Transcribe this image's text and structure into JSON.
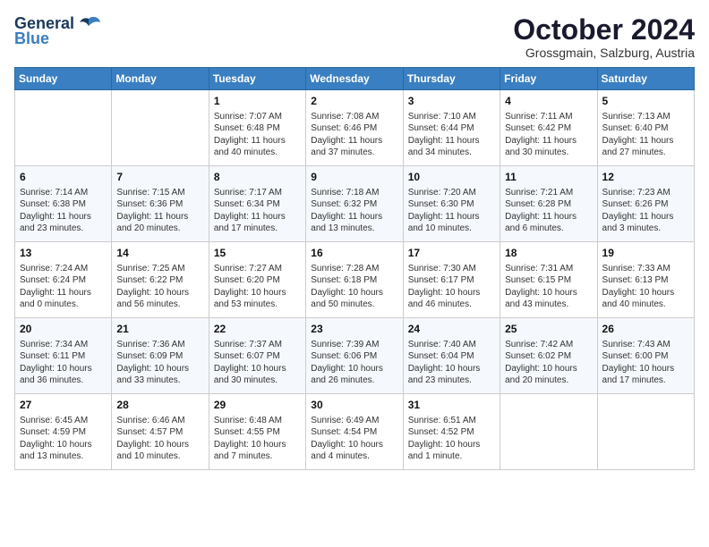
{
  "header": {
    "logo_general": "General",
    "logo_blue": "Blue",
    "month_title": "October 2024",
    "location": "Grossgmain, Salzburg, Austria"
  },
  "days_of_week": [
    "Sunday",
    "Monday",
    "Tuesday",
    "Wednesday",
    "Thursday",
    "Friday",
    "Saturday"
  ],
  "weeks": [
    [
      {
        "day": "",
        "info": ""
      },
      {
        "day": "",
        "info": ""
      },
      {
        "day": "1",
        "info": "Sunrise: 7:07 AM\nSunset: 6:48 PM\nDaylight: 11 hours and 40 minutes."
      },
      {
        "day": "2",
        "info": "Sunrise: 7:08 AM\nSunset: 6:46 PM\nDaylight: 11 hours and 37 minutes."
      },
      {
        "day": "3",
        "info": "Sunrise: 7:10 AM\nSunset: 6:44 PM\nDaylight: 11 hours and 34 minutes."
      },
      {
        "day": "4",
        "info": "Sunrise: 7:11 AM\nSunset: 6:42 PM\nDaylight: 11 hours and 30 minutes."
      },
      {
        "day": "5",
        "info": "Sunrise: 7:13 AM\nSunset: 6:40 PM\nDaylight: 11 hours and 27 minutes."
      }
    ],
    [
      {
        "day": "6",
        "info": "Sunrise: 7:14 AM\nSunset: 6:38 PM\nDaylight: 11 hours and 23 minutes."
      },
      {
        "day": "7",
        "info": "Sunrise: 7:15 AM\nSunset: 6:36 PM\nDaylight: 11 hours and 20 minutes."
      },
      {
        "day": "8",
        "info": "Sunrise: 7:17 AM\nSunset: 6:34 PM\nDaylight: 11 hours and 17 minutes."
      },
      {
        "day": "9",
        "info": "Sunrise: 7:18 AM\nSunset: 6:32 PM\nDaylight: 11 hours and 13 minutes."
      },
      {
        "day": "10",
        "info": "Sunrise: 7:20 AM\nSunset: 6:30 PM\nDaylight: 11 hours and 10 minutes."
      },
      {
        "day": "11",
        "info": "Sunrise: 7:21 AM\nSunset: 6:28 PM\nDaylight: 11 hours and 6 minutes."
      },
      {
        "day": "12",
        "info": "Sunrise: 7:23 AM\nSunset: 6:26 PM\nDaylight: 11 hours and 3 minutes."
      }
    ],
    [
      {
        "day": "13",
        "info": "Sunrise: 7:24 AM\nSunset: 6:24 PM\nDaylight: 11 hours and 0 minutes."
      },
      {
        "day": "14",
        "info": "Sunrise: 7:25 AM\nSunset: 6:22 PM\nDaylight: 10 hours and 56 minutes."
      },
      {
        "day": "15",
        "info": "Sunrise: 7:27 AM\nSunset: 6:20 PM\nDaylight: 10 hours and 53 minutes."
      },
      {
        "day": "16",
        "info": "Sunrise: 7:28 AM\nSunset: 6:18 PM\nDaylight: 10 hours and 50 minutes."
      },
      {
        "day": "17",
        "info": "Sunrise: 7:30 AM\nSunset: 6:17 PM\nDaylight: 10 hours and 46 minutes."
      },
      {
        "day": "18",
        "info": "Sunrise: 7:31 AM\nSunset: 6:15 PM\nDaylight: 10 hours and 43 minutes."
      },
      {
        "day": "19",
        "info": "Sunrise: 7:33 AM\nSunset: 6:13 PM\nDaylight: 10 hours and 40 minutes."
      }
    ],
    [
      {
        "day": "20",
        "info": "Sunrise: 7:34 AM\nSunset: 6:11 PM\nDaylight: 10 hours and 36 minutes."
      },
      {
        "day": "21",
        "info": "Sunrise: 7:36 AM\nSunset: 6:09 PM\nDaylight: 10 hours and 33 minutes."
      },
      {
        "day": "22",
        "info": "Sunrise: 7:37 AM\nSunset: 6:07 PM\nDaylight: 10 hours and 30 minutes."
      },
      {
        "day": "23",
        "info": "Sunrise: 7:39 AM\nSunset: 6:06 PM\nDaylight: 10 hours and 26 minutes."
      },
      {
        "day": "24",
        "info": "Sunrise: 7:40 AM\nSunset: 6:04 PM\nDaylight: 10 hours and 23 minutes."
      },
      {
        "day": "25",
        "info": "Sunrise: 7:42 AM\nSunset: 6:02 PM\nDaylight: 10 hours and 20 minutes."
      },
      {
        "day": "26",
        "info": "Sunrise: 7:43 AM\nSunset: 6:00 PM\nDaylight: 10 hours and 17 minutes."
      }
    ],
    [
      {
        "day": "27",
        "info": "Sunrise: 6:45 AM\nSunset: 4:59 PM\nDaylight: 10 hours and 13 minutes."
      },
      {
        "day": "28",
        "info": "Sunrise: 6:46 AM\nSunset: 4:57 PM\nDaylight: 10 hours and 10 minutes."
      },
      {
        "day": "29",
        "info": "Sunrise: 6:48 AM\nSunset: 4:55 PM\nDaylight: 10 hours and 7 minutes."
      },
      {
        "day": "30",
        "info": "Sunrise: 6:49 AM\nSunset: 4:54 PM\nDaylight: 10 hours and 4 minutes."
      },
      {
        "day": "31",
        "info": "Sunrise: 6:51 AM\nSunset: 4:52 PM\nDaylight: 10 hours and 1 minute."
      },
      {
        "day": "",
        "info": ""
      },
      {
        "day": "",
        "info": ""
      }
    ]
  ]
}
